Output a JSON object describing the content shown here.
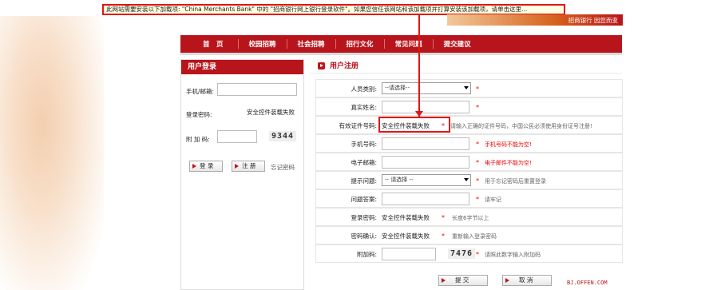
{
  "infobar": {
    "text": "此网站需要安装以下加载项: \"China Merchants Bank\" 中的 \"招商银行网上银行登录软件\"。如果您信任该网站和该加载项并打算安装该加载项，请单击这里..."
  },
  "banner": {
    "text": "招商银行 因您而变"
  },
  "nav": {
    "items": [
      "首　页",
      "校园招聘",
      "社会招聘",
      "招行文化",
      "常见问题",
      "提交建议"
    ]
  },
  "login": {
    "title": "用户登录",
    "phone_label": "手机/邮箱:",
    "password_label": "登录密码:",
    "password_status": "安全控件装载失败",
    "captcha_label": "附 加 码:",
    "captcha_value": "9344",
    "login_button": "登 录",
    "register_button": "注 册",
    "forgot_link": "忘记密码"
  },
  "register": {
    "title": "用户注册",
    "rows": {
      "type_label": "人员类别:",
      "type_value": "--请选择--",
      "name_label": "真实姓名:",
      "id_label": "有效证件号码:",
      "id_value": "安全控件装载失败",
      "id_hint": "请输入正确的证件号码，中国公民必须使用身份证号注册!",
      "phone_label": "手机号码:",
      "phone_error": "手机号码不能为空!",
      "email_label": "电子邮箱:",
      "email_error": "电子邮件不能为空!",
      "question_label": "提示问题:",
      "question_value": "-- 请选择 --",
      "question_hint": "用于忘记密码后重置登录",
      "answer_label": "问题答案:",
      "answer_hint": "请牢记",
      "pwd_label": "登录密码:",
      "pwd_value": "安全控件装载失败",
      "pwd_hint": "长度6字节以上",
      "pwd2_label": "密码确认:",
      "pwd2_value": "安全控件装载失败",
      "pwd2_hint": "重新输入登录密码",
      "captcha_label": "附加码:",
      "captcha_value": "7476",
      "captcha_hint": "请照此数字输入附加码"
    },
    "submit_button": "提 交",
    "cancel_button": "取 消"
  },
  "required_mark": "*",
  "watermark": "BJ.OFFEN.COM",
  "colors": {
    "brand_red": "#b8141b",
    "highlight_red": "#e21414",
    "infobar_bg": "#ffffe1"
  }
}
